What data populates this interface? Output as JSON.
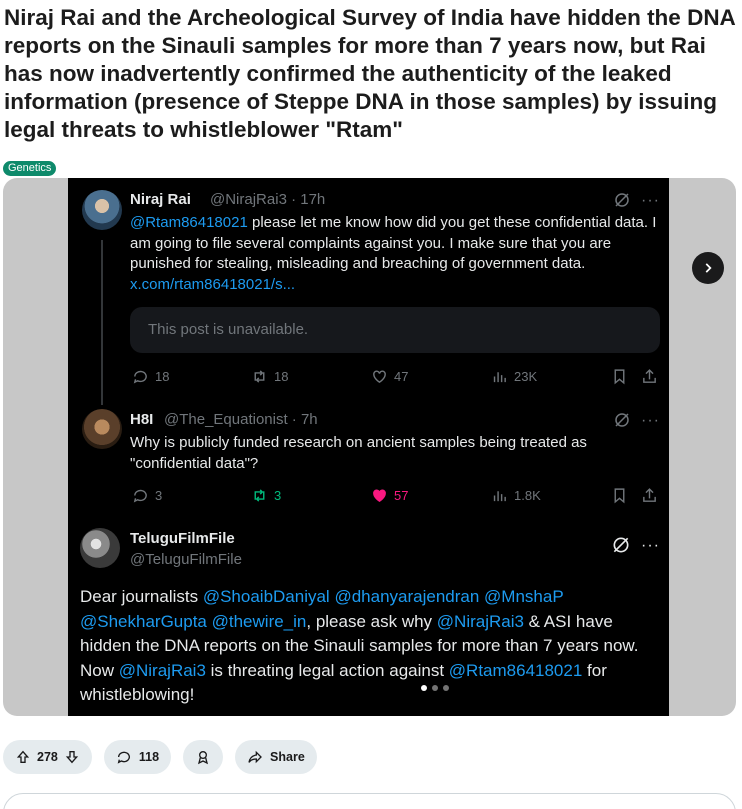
{
  "post": {
    "title": "Niraj Rai and the Archeological Survey of India have hidden the DNA reports on the Sinauli samples for more than 7 years now, but Rai has now inadvertently confirmed the authenticity of the leaked information (presence of Steppe DNA in those samples) by issuing legal threats to whistleblower \"Rtam\"",
    "flair": "Genetics",
    "flair_color": "#0e8a6b"
  },
  "tweets": [
    {
      "name": "Niraj Rai",
      "handle_time": "@NirajRai3 · 17h",
      "mention": "@Rtam86418021",
      "text": " please let me know how did you get these confidential data. I am going to file several complaints against you. I make sure that you are punished for stealing, misleading and breaching of government data.",
      "link": "x.com/rtam86418021/s...",
      "quote": "This post is unavailable.",
      "replies": "18",
      "retweets": "18",
      "likes": "47",
      "views": "23K"
    },
    {
      "name": "Η8Ι",
      "handle_time": "@The_Equationist · 7h",
      "text": "Why is publicly funded research on ancient samples being treated as \"confidential data\"?",
      "replies": "3",
      "retweets": "3",
      "likes": "57",
      "views": "1.8K"
    },
    {
      "name": "TeluguFilmFile",
      "handle": "@TeluguFilmFile",
      "segments": [
        {
          "t": "Dear journalists ",
          "link": false
        },
        {
          "t": "@ShoaibDaniyal",
          "link": true
        },
        {
          "t": " ",
          "link": false
        },
        {
          "t": "@dhanyarajendran",
          "link": true
        },
        {
          "t": " ",
          "link": false
        },
        {
          "t": "@MnshaP",
          "link": true
        },
        {
          "t": " ",
          "link": false
        },
        {
          "t": "@ShekharGupta",
          "link": true
        },
        {
          "t": " ",
          "link": false
        },
        {
          "t": "@thewire_in",
          "link": true
        },
        {
          "t": ", please ask why ",
          "link": false
        },
        {
          "t": "@NirajRai3",
          "link": true
        },
        {
          "t": " & ASI have hidden the DNA reports on the Sinauli samples for more than 7 years now. Now ",
          "link": false
        },
        {
          "t": "@NirajRai3",
          "link": true
        },
        {
          "t": " is threating legal action against ",
          "link": false
        },
        {
          "t": "@Rtam86418021",
          "link": true
        },
        {
          "t": " for whistleblowing!",
          "link": false
        }
      ]
    }
  ],
  "actions": {
    "upvotes": "278",
    "comments": "118",
    "share_label": "Share"
  },
  "icons": {
    "next": "chevron-right-icon",
    "upvote": "arrow-up-icon",
    "downvote": "arrow-down-icon",
    "comment": "comment-bubble-icon",
    "award": "award-icon",
    "share": "share-arrow-icon"
  },
  "colors": {
    "link": "#1d9bf0",
    "retweet_active": "#00ba7c",
    "like_active": "#f91880"
  }
}
